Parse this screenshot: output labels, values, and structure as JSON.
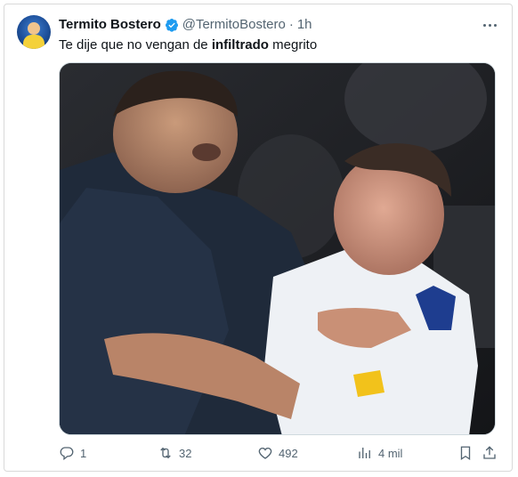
{
  "tweet": {
    "author_name": "Termito Bostero",
    "handle": "@TermitoBostero",
    "separator": "·",
    "time": "1h",
    "text_before": "Te dije que no vengan de ",
    "text_bold": "infiltrado",
    "text_after": " megrito",
    "media_description": "two men in a stadium crowd, one in dark jacket grabbing another in white jersey number 12"
  },
  "actions": {
    "replies": "1",
    "retweets": "32",
    "likes": "492",
    "views": "4 mil"
  },
  "colors": {
    "verified": "#1d9bf0",
    "icon": "#536471",
    "text": "#0f1419"
  },
  "icons": [
    "more-icon",
    "verified-icon",
    "reply-icon",
    "retweet-icon",
    "like-icon",
    "views-icon",
    "bookmark-icon",
    "share-icon"
  ]
}
